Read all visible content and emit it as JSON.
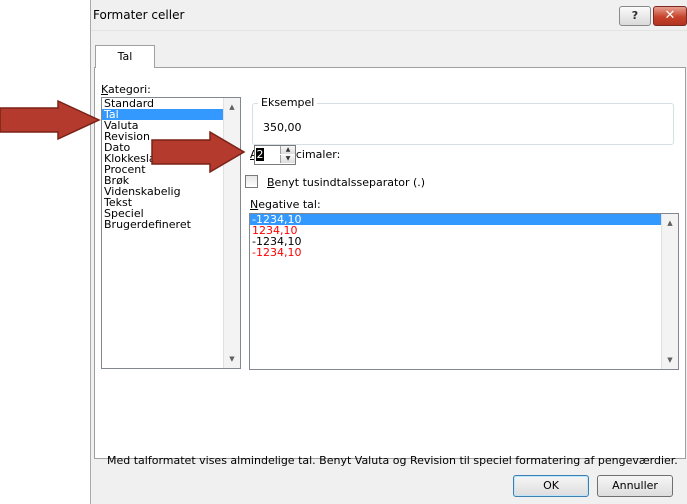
{
  "dialog": {
    "title": "Formater celler",
    "help_label": "?",
    "close_label": "✕"
  },
  "tabs": [
    {
      "label": "Tal"
    }
  ],
  "category": {
    "label_prefix": "K",
    "label_rest": "ategori:",
    "items": [
      "Standard",
      "Tal",
      "Valuta",
      "Revision",
      "Dato",
      "Klokkeslæt",
      "Procent",
      "Brøk",
      "Videnskabelig",
      "Tekst",
      "Speciel",
      "Brugerdefineret"
    ],
    "selected": "Tal"
  },
  "sample": {
    "legend": "Eksempel",
    "value": "350,00"
  },
  "decimals": {
    "label_prefix": "A",
    "label_rest": "ntal decimaler:",
    "value": "2"
  },
  "thousands": {
    "label_prefix": "B",
    "label_rest": "enyt tusindtalsseparator (.)",
    "checked": false
  },
  "negative": {
    "label_prefix": "N",
    "label_rest": "egative tal:",
    "items": [
      {
        "text": "-1234,10",
        "color": "#000000",
        "selected": true
      },
      {
        "text": "1234,10",
        "color": "#ff0000",
        "selected": false
      },
      {
        "text": "-1234,10",
        "color": "#000000",
        "selected": false
      },
      {
        "text": "-1234,10",
        "color": "#ff0000",
        "selected": false
      }
    ]
  },
  "description": "Med talformatet vises almindelige tal. Benyt Valuta og Revision til speciel formatering af pengeværdier.",
  "buttons": {
    "ok": "OK",
    "cancel": "Annuller"
  },
  "colors": {
    "selection": "#3399ff",
    "arrow_fill": "#b33a2c",
    "arrow_stroke": "#7a2218",
    "negative_red": "#ff0000"
  }
}
